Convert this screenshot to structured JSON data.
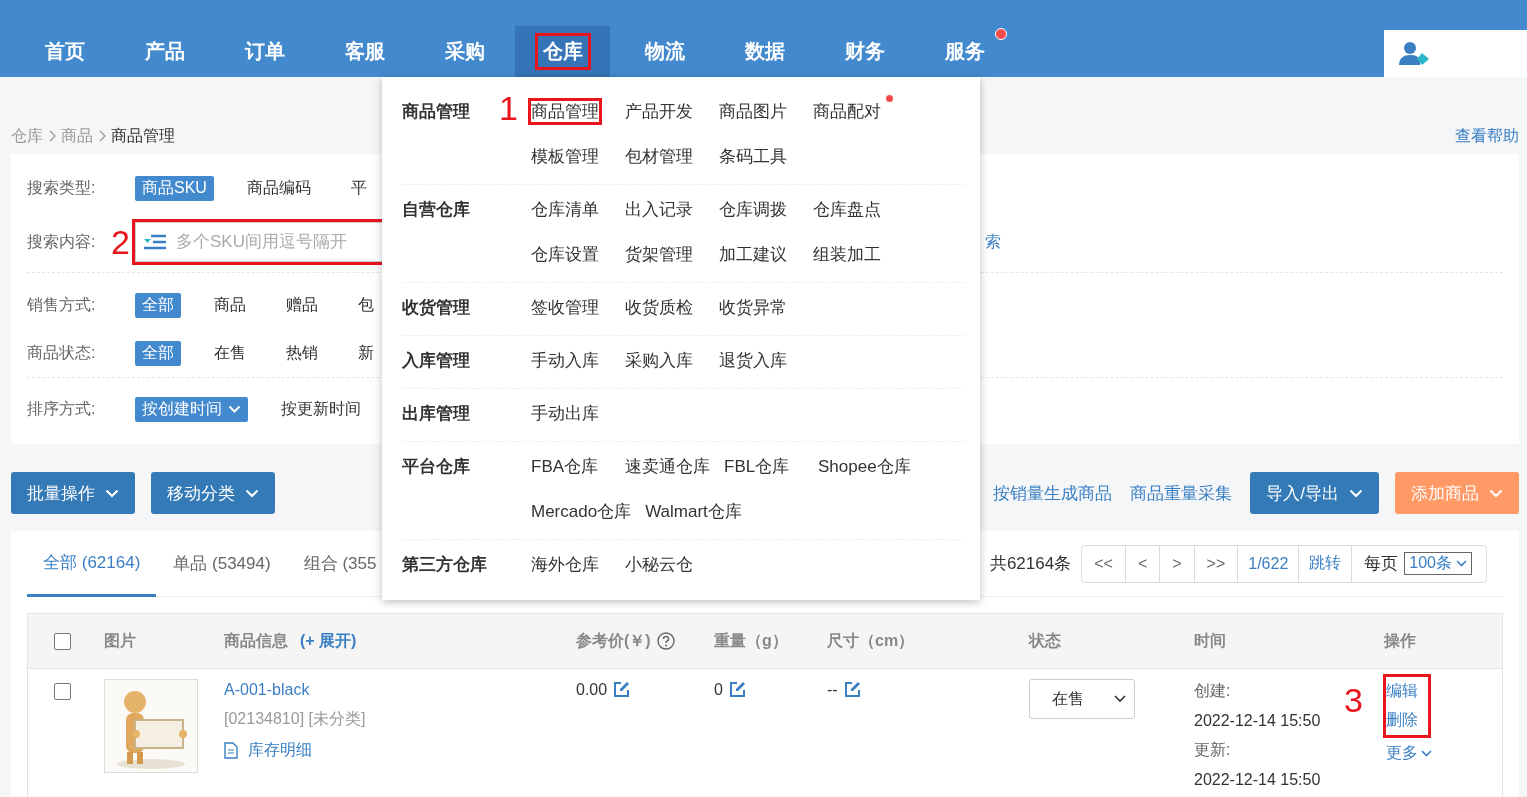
{
  "nav": {
    "items": [
      {
        "label": "首页",
        "selected": false,
        "highlighted": false,
        "notification": false
      },
      {
        "label": "产品",
        "selected": false,
        "highlighted": false,
        "notification": false
      },
      {
        "label": "订单",
        "selected": false,
        "highlighted": false,
        "notification": false
      },
      {
        "label": "客服",
        "selected": false,
        "highlighted": false,
        "notification": false
      },
      {
        "label": "采购",
        "selected": false,
        "highlighted": false,
        "notification": false
      },
      {
        "label": "仓库",
        "selected": true,
        "highlighted": true,
        "notification": false
      },
      {
        "label": "物流",
        "selected": false,
        "highlighted": false,
        "notification": false
      },
      {
        "label": "数据",
        "selected": false,
        "highlighted": false,
        "notification": false
      },
      {
        "label": "财务",
        "selected": false,
        "highlighted": false,
        "notification": false
      },
      {
        "label": "服务",
        "selected": false,
        "highlighted": false,
        "notification": true
      }
    ]
  },
  "breadcrumb": [
    "仓库",
    "商品",
    "商品管理"
  ],
  "help_link": "查看帮助",
  "filter_groups": [
    [
      {
        "kind": "options",
        "label": "搜索类型:",
        "options": [
          {
            "label": "商品SKU",
            "selected": true
          },
          {
            "label": "商品编码",
            "selected": false
          },
          {
            "label": "平",
            "selected": false
          }
        ]
      },
      {
        "kind": "search",
        "label": "搜索内容:",
        "placeholder": "多个SKU间用逗号隔开",
        "callout": "2",
        "button": "索"
      }
    ],
    [
      {
        "kind": "options",
        "label": "销售方式:",
        "options": [
          {
            "label": "全部",
            "selected": true
          },
          {
            "label": "商品",
            "selected": false
          },
          {
            "label": "赠品",
            "selected": false
          },
          {
            "label": "包",
            "selected": false
          }
        ]
      },
      {
        "kind": "options",
        "label": "商品状态:",
        "options": [
          {
            "label": "全部",
            "selected": true
          },
          {
            "label": "在售",
            "selected": false
          },
          {
            "label": "热销",
            "selected": false
          },
          {
            "label": "新",
            "selected": false
          }
        ]
      }
    ],
    [
      {
        "kind": "sort",
        "label": "排序方式:",
        "options": [
          {
            "label": "按创建时间",
            "selected": true
          },
          {
            "label": "按更新时间",
            "selected": false
          }
        ]
      }
    ]
  ],
  "toolbar": {
    "left": [
      "批量操作",
      "移动分类"
    ],
    "links": [
      "按销量生成商品",
      "商品重量采集"
    ],
    "right": [
      {
        "label": "导入/导出",
        "kind": "primary"
      },
      {
        "label": "添加商品",
        "kind": "warning"
      }
    ]
  },
  "tabs": [
    {
      "label": "全部 (62164)",
      "selected": true
    },
    {
      "label": "单品 (53494)",
      "selected": false
    },
    {
      "label": "组合 (355",
      "selected": false
    }
  ],
  "pagination": {
    "total": "共62164条",
    "buttons": [
      "<<",
      "<",
      ">",
      ">>"
    ],
    "page": "1/622",
    "jump": "跳转",
    "per_page_label": "每页",
    "per_page": "100条"
  },
  "table": {
    "select_all_checked": false,
    "columns": [
      {
        "label": "图片"
      },
      {
        "label": "商品信息",
        "extra": "(+ 展开)"
      },
      {
        "label": "参考价(￥)",
        "help": true
      },
      {
        "label": "重量（g）"
      },
      {
        "label": "尺寸（cm）"
      },
      {
        "label": "状态"
      },
      {
        "label": "时间"
      },
      {
        "label": "操作"
      }
    ],
    "rows": [
      {
        "checked": false,
        "sku": "A-001-black",
        "code": "[02134810] [未分类]",
        "stock_link": "库存明细",
        "price": "0.00",
        "weight": "0",
        "size": "--",
        "status": "在售",
        "created_label": "创建:",
        "created": "2022-12-14 15:50",
        "updated_label": "更新:",
        "updated": "2022-12-14 15:50",
        "actions": [
          "编辑",
          "删除"
        ],
        "more": "更多",
        "callout": "3"
      }
    ]
  },
  "menu": {
    "sections": [
      {
        "title": "商品管理",
        "rows": [
          [
            {
              "label": "商品管理",
              "highlighted": true,
              "callout": "1"
            },
            {
              "label": "产品开发",
              "highlighted": false
            },
            {
              "label": "商品图片",
              "highlighted": false
            },
            {
              "label": "商品配对",
              "highlighted": false,
              "notification": true
            }
          ],
          [
            {
              "label": "模板管理",
              "highlighted": false
            },
            {
              "label": "包材管理",
              "highlighted": false
            },
            {
              "label": "条码工具",
              "highlighted": false
            }
          ]
        ]
      },
      {
        "title": "自营仓库",
        "rows": [
          [
            {
              "label": "仓库清单",
              "highlighted": false
            },
            {
              "label": "出入记录",
              "highlighted": false
            },
            {
              "label": "仓库调拨",
              "highlighted": false
            },
            {
              "label": "仓库盘点",
              "highlighted": false
            }
          ],
          [
            {
              "label": "仓库设置",
              "highlighted": false
            },
            {
              "label": "货架管理",
              "highlighted": false
            },
            {
              "label": "加工建议",
              "highlighted": false
            },
            {
              "label": "组装加工",
              "highlighted": false
            }
          ]
        ]
      },
      {
        "title": "收货管理",
        "rows": [
          [
            {
              "label": "签收管理",
              "highlighted": false
            },
            {
              "label": "收货质检",
              "highlighted": false
            },
            {
              "label": "收货异常",
              "highlighted": false
            }
          ]
        ]
      },
      {
        "title": "入库管理",
        "rows": [
          [
            {
              "label": "手动入库",
              "highlighted": false
            },
            {
              "label": "采购入库",
              "highlighted": false
            },
            {
              "label": "退货入库",
              "highlighted": false
            }
          ]
        ]
      },
      {
        "title": "出库管理",
        "rows": [
          [
            {
              "label": "手动出库",
              "highlighted": false
            }
          ]
        ]
      },
      {
        "title": "平台仓库",
        "rows": [
          [
            {
              "label": "FBA仓库",
              "highlighted": false
            },
            {
              "label": "速卖通仓库",
              "highlighted": false
            },
            {
              "label": "FBL仓库",
              "highlighted": false
            },
            {
              "label": "Shopee仓库",
              "highlighted": false
            }
          ],
          [
            {
              "label": "Mercado仓库",
              "highlighted": false
            },
            {
              "label": "Walmart仓库",
              "highlighted": false
            }
          ]
        ]
      },
      {
        "title": "第三方仓库",
        "rows": [
          [
            {
              "label": "海外仓库",
              "highlighted": false
            },
            {
              "label": "小秘云仓",
              "highlighted": false
            }
          ]
        ]
      }
    ]
  }
}
